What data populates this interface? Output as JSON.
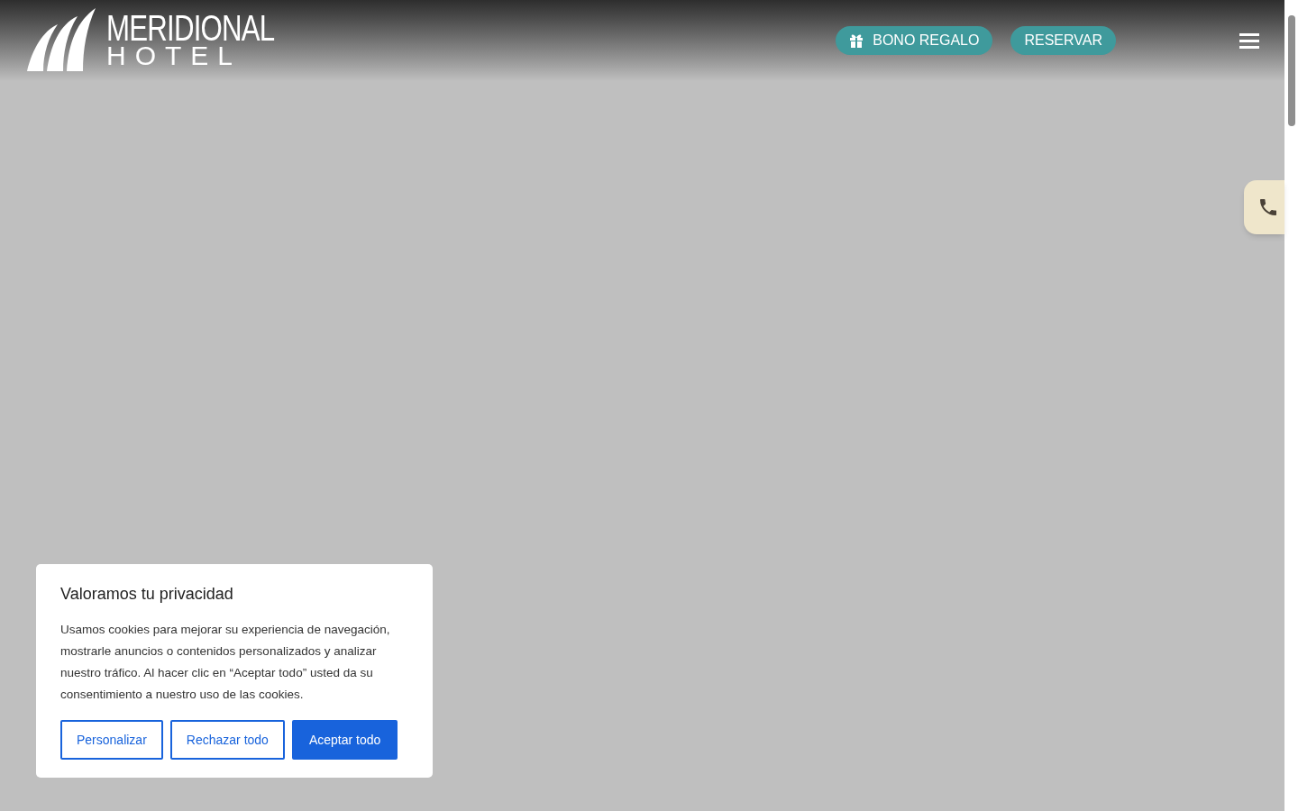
{
  "logo": {
    "name": "MERIDIONAL",
    "subtitle": "HOTEL"
  },
  "header_buttons": [
    {
      "label": "BONO REGALO",
      "kind": "gift"
    },
    {
      "label": "RESERVAR",
      "kind": "plain"
    }
  ],
  "cookie_banner": {
    "title": "Valoramos tu privacidad",
    "text": "Usamos cookies para mejorar su experiencia de navegación, mostrarle anuncios o contenidos personalizados y analizar nuestro tráfico. Al hacer clic en “Aceptar todo” usted da su consentimiento a nuestro uso de las cookies.",
    "buttons": [
      {
        "label": "Personalizar",
        "kind": "outline"
      },
      {
        "label": "Rechazar todo",
        "kind": "outline"
      },
      {
        "label": "Aceptar todo",
        "kind": "primary"
      }
    ]
  }
}
